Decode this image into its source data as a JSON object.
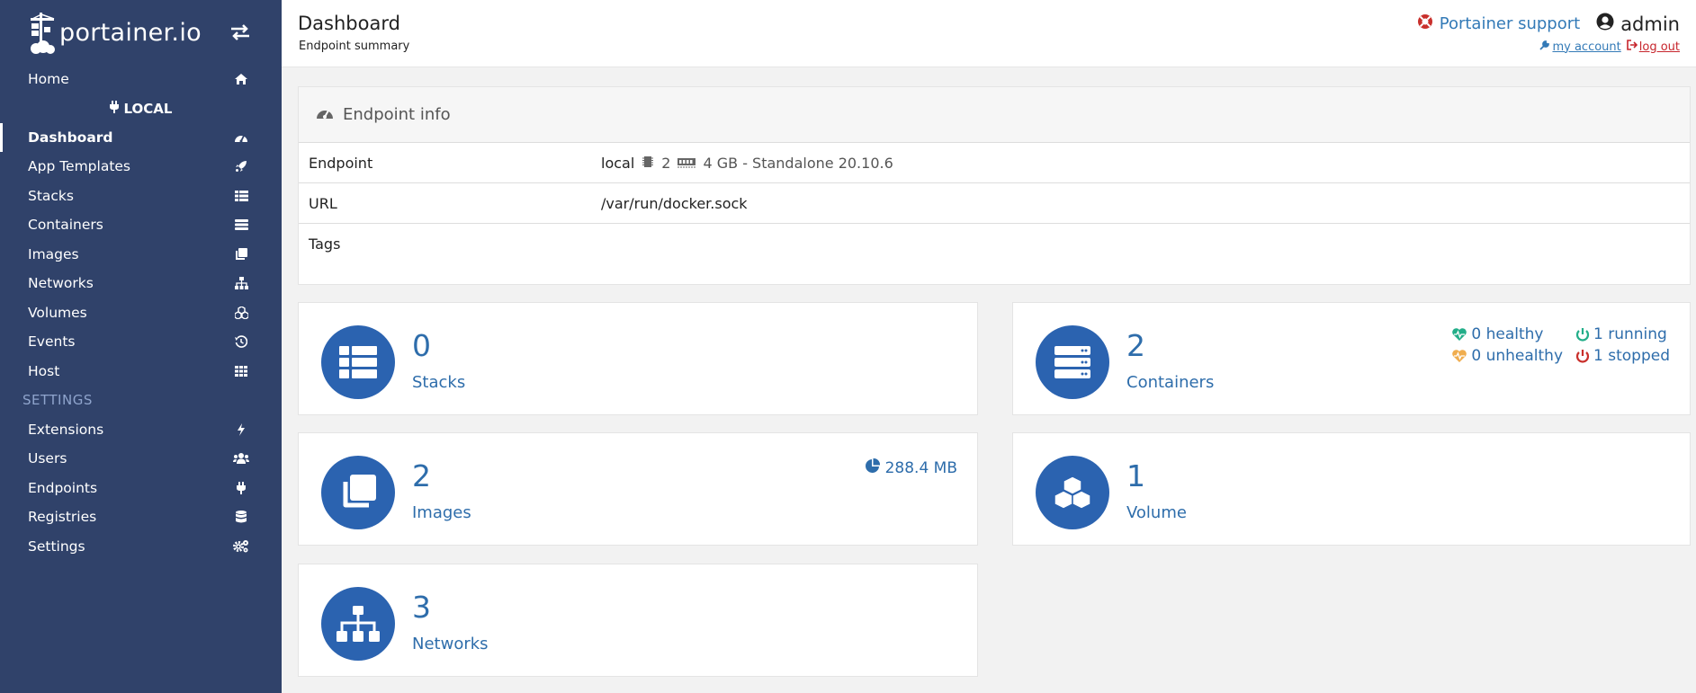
{
  "brand": {
    "name": "portainer.io"
  },
  "sidebar": {
    "home": "Home",
    "endpoint_name": "LOCAL",
    "items": [
      {
        "label": "Dashboard",
        "icon": "dashboard-icon"
      },
      {
        "label": "App Templates",
        "icon": "rocket-icon"
      },
      {
        "label": "Stacks",
        "icon": "th-list-icon"
      },
      {
        "label": "Containers",
        "icon": "server-icon"
      },
      {
        "label": "Images",
        "icon": "clone-icon"
      },
      {
        "label": "Networks",
        "icon": "sitemap-icon"
      },
      {
        "label": "Volumes",
        "icon": "cubes-icon"
      },
      {
        "label": "Events",
        "icon": "history-icon"
      },
      {
        "label": "Host",
        "icon": "th-icon"
      }
    ],
    "settings_title": "SETTINGS",
    "settings_items": [
      {
        "label": "Extensions",
        "icon": "bolt-icon"
      },
      {
        "label": "Users",
        "icon": "users-icon"
      },
      {
        "label": "Endpoints",
        "icon": "plug-icon"
      },
      {
        "label": "Registries",
        "icon": "database-icon"
      },
      {
        "label": "Settings",
        "icon": "cogs-icon"
      }
    ]
  },
  "header": {
    "title": "Dashboard",
    "subtitle": "Endpoint summary",
    "support": "Portainer support",
    "user": "admin",
    "my_account": "my account",
    "log_out": "log out"
  },
  "endpoint_info": {
    "title": "Endpoint info",
    "rows": {
      "endpoint_key": "Endpoint",
      "endpoint_name": "local",
      "cpu": "2",
      "memory_details": "4 GB - Standalone 20.10.6",
      "url_key": "URL",
      "url": "/var/run/docker.sock",
      "tags_key": "Tags"
    }
  },
  "widgets": {
    "stacks": {
      "count": "0",
      "label": "Stacks"
    },
    "containers": {
      "count": "2",
      "label": "Containers",
      "healthy": "0 healthy",
      "running": "1 running",
      "unhealthy": "0 unhealthy",
      "stopped": "1 stopped"
    },
    "images": {
      "count": "2",
      "label": "Images",
      "size": "288.4 MB"
    },
    "volumes": {
      "count": "1",
      "label": "Volume"
    },
    "networks": {
      "count": "3",
      "label": "Networks"
    }
  },
  "colors": {
    "sidebar": "#30426a",
    "accent": "#2b63b0",
    "healthy": "#23ae89",
    "unhealthy": "#f0ad4e",
    "stopped": "#c9302c",
    "link": "#337ab7"
  }
}
